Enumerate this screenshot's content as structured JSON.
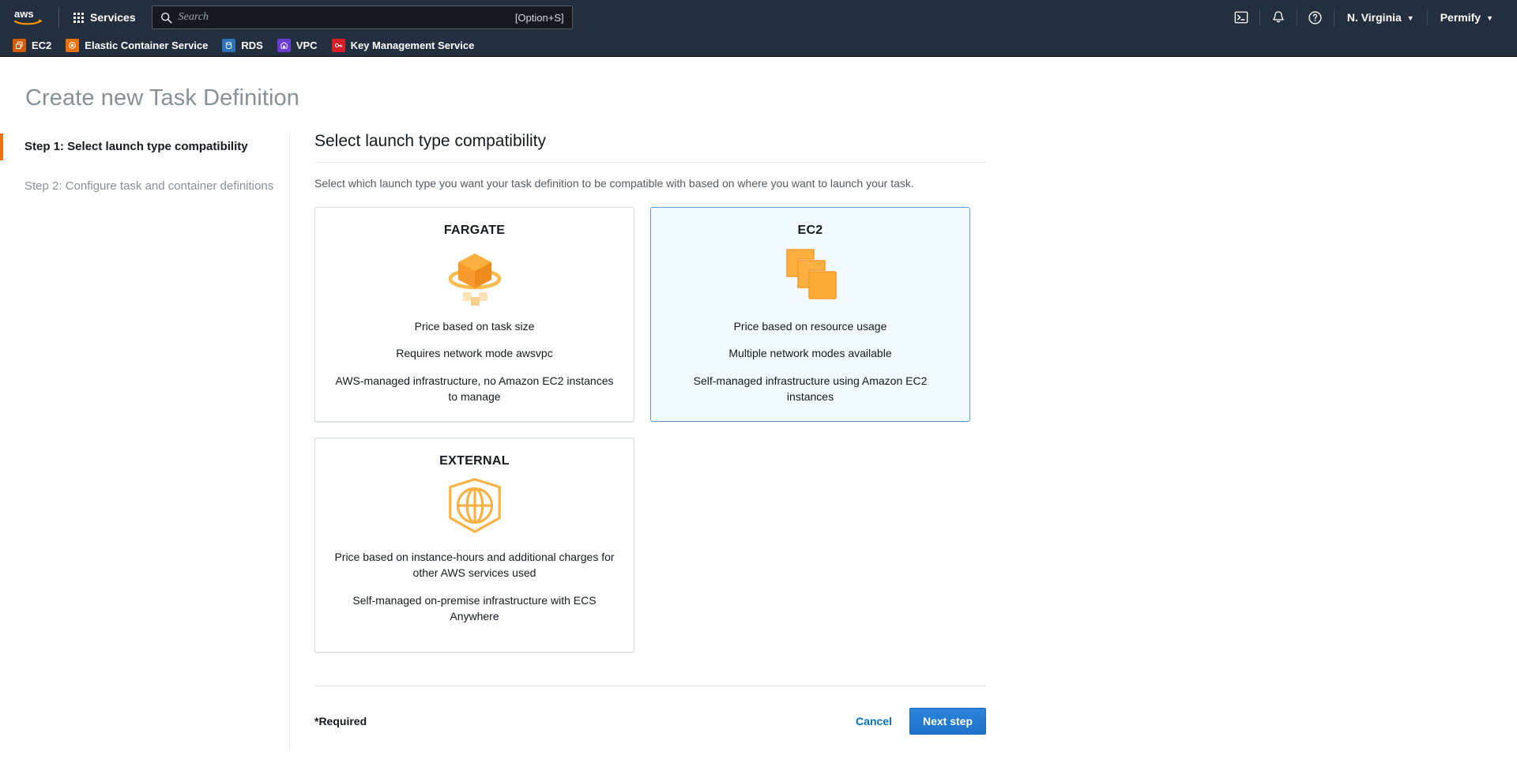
{
  "topnav": {
    "logo": "aws-logo",
    "services_label": "Services",
    "search": {
      "placeholder": "Search",
      "shortcut": "[Option+S]",
      "icon": "search-icon"
    },
    "right_items": [
      {
        "type": "icon",
        "name": "cloudshell-icon"
      },
      {
        "type": "icon",
        "name": "bell-icon"
      },
      {
        "type": "icon",
        "name": "help-icon"
      },
      {
        "type": "text",
        "name": "region-selector",
        "label": "N. Virginia"
      },
      {
        "type": "text",
        "name": "account-menu",
        "label": "Permify"
      }
    ]
  },
  "favbar": {
    "items": [
      {
        "label": "EC2",
        "icon": "ec2-icon",
        "color": "#d45b07"
      },
      {
        "label": "Elastic Container Service",
        "icon": "ecs-icon",
        "color": "#e8710a"
      },
      {
        "label": "RDS",
        "icon": "rds-icon",
        "color": "#2e73b8"
      },
      {
        "label": "VPC",
        "icon": "vpc-icon",
        "color": "#6b3bd6"
      },
      {
        "label": "Key Management Service",
        "icon": "kms-icon",
        "color": "#d81f26"
      }
    ]
  },
  "page": {
    "title": "Create new Task Definition"
  },
  "sidebar": {
    "steps": [
      {
        "label": "Step 1: Select launch type compatibility",
        "active": true
      },
      {
        "label": "Step 2: Configure task and container definitions",
        "active": false
      }
    ],
    "accent_color": "#ec7211"
  },
  "main": {
    "heading": "Select launch type compatibility",
    "description": "Select which launch type you want your task definition to be compatible with based on where you want to launch your task.",
    "cards": [
      {
        "title": "FARGATE",
        "icon": "fargate-cube-icon",
        "selected": false,
        "lines": [
          "Price based on task size",
          "Requires network mode awsvpc",
          "AWS-managed infrastructure, no Amazon EC2 instances to manage"
        ]
      },
      {
        "title": "EC2",
        "icon": "ec2-stack-icon",
        "selected": true,
        "lines": [
          "Price based on resource usage",
          "Multiple network modes available",
          "Self-managed infrastructure using Amazon EC2 instances"
        ]
      },
      {
        "title": "EXTERNAL",
        "icon": "external-globe-icon",
        "selected": false,
        "lines": [
          "Price based on instance-hours and additional charges for other AWS services used",
          "Self-managed on-premise infrastructure with ECS Anywhere"
        ]
      }
    ]
  },
  "footer": {
    "required_note": "*Required",
    "cancel_label": "Cancel",
    "next_label": "Next step",
    "primary_color": "#2b84da",
    "link_color": "#0073bb"
  }
}
